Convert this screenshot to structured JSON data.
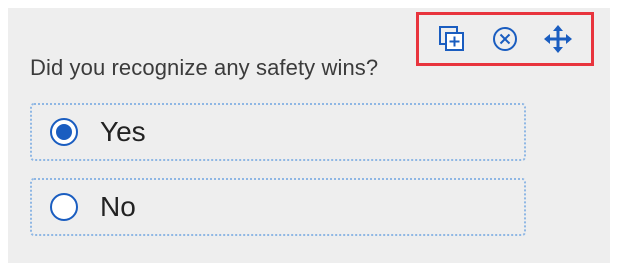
{
  "toolbar": {
    "icons": [
      "duplicate-icon",
      "remove-icon",
      "move-icon"
    ]
  },
  "question": {
    "text": "Did you recognize any safety wins?"
  },
  "options": [
    {
      "label": "Yes",
      "selected": true
    },
    {
      "label": "No",
      "selected": false
    }
  ],
  "colors": {
    "accent": "#1a5dc0",
    "highlight_border": "#e8343d",
    "option_border": "#8fb7e4",
    "card_background": "#eeeeee"
  }
}
